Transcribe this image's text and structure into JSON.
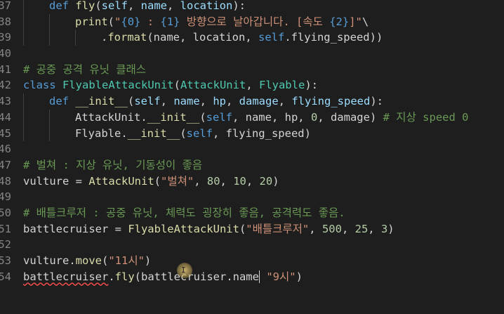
{
  "editor": {
    "lines": [
      {
        "n": "37",
        "tokens": [
          [
            "kw",
            "def "
          ],
          [
            "fn",
            "fly"
          ],
          [
            "plain",
            "("
          ],
          [
            "var",
            "self"
          ],
          [
            "plain",
            ", "
          ],
          [
            "var",
            "name"
          ],
          [
            "plain",
            ", "
          ],
          [
            "var",
            "location"
          ],
          [
            "plain",
            "):"
          ]
        ],
        "indent": 1
      },
      {
        "n": "38",
        "tokens": [
          [
            "fn",
            "print"
          ],
          [
            "plain",
            "("
          ],
          [
            "str",
            "\""
          ],
          [
            "fmt",
            "{0}"
          ],
          [
            "str",
            " : "
          ],
          [
            "fmt",
            "{1}"
          ],
          [
            "str",
            " 방향으로 날아갑니다. [속도 "
          ],
          [
            "fmt",
            "{2}"
          ],
          [
            "str",
            "]\""
          ],
          [
            "plain",
            "\\"
          ]
        ],
        "indent": 2
      },
      {
        "n": "39",
        "tokens": [
          [
            "plain",
            "."
          ],
          [
            "fn",
            "format"
          ],
          [
            "plain",
            "(name, location, "
          ],
          [
            "self",
            "self"
          ],
          [
            "plain",
            ".flying_speed))"
          ]
        ],
        "indent": 3
      },
      {
        "n": "40",
        "tokens": [],
        "indent": 0
      },
      {
        "n": "41",
        "tokens": [
          [
            "cmt",
            "# 공중 공격 유닛 클래스"
          ]
        ],
        "indent": 0
      },
      {
        "n": "42",
        "tokens": [
          [
            "kw",
            "class "
          ],
          [
            "cls",
            "FlyableAttackUnit"
          ],
          [
            "plain",
            "("
          ],
          [
            "cls",
            "AttackUnit"
          ],
          [
            "plain",
            ", "
          ],
          [
            "cls",
            "Flyable"
          ],
          [
            "plain",
            "):"
          ]
        ],
        "indent": 0
      },
      {
        "n": "43",
        "tokens": [
          [
            "kw",
            "def "
          ],
          [
            "fn",
            "__init__"
          ],
          [
            "plain",
            "("
          ],
          [
            "var",
            "self"
          ],
          [
            "plain",
            ", "
          ],
          [
            "var",
            "name"
          ],
          [
            "plain",
            ", "
          ],
          [
            "var",
            "hp"
          ],
          [
            "plain",
            ", "
          ],
          [
            "var",
            "damage"
          ],
          [
            "plain",
            ", "
          ],
          [
            "var",
            "flying_speed"
          ],
          [
            "plain",
            "):"
          ]
        ],
        "indent": 1
      },
      {
        "n": "44",
        "tokens": [
          [
            "plain",
            "AttackUnit."
          ],
          [
            "fn",
            "__init__"
          ],
          [
            "plain",
            "("
          ],
          [
            "self",
            "self"
          ],
          [
            "plain",
            ", name, hp, "
          ],
          [
            "num",
            "0"
          ],
          [
            "plain",
            ", damage) "
          ],
          [
            "cmt",
            "# 지상 speed 0"
          ]
        ],
        "indent": 2
      },
      {
        "n": "45",
        "tokens": [
          [
            "plain",
            "Flyable."
          ],
          [
            "fn",
            "__init__"
          ],
          [
            "plain",
            "("
          ],
          [
            "self",
            "self"
          ],
          [
            "plain",
            ", flying_speed)"
          ]
        ],
        "indent": 2
      },
      {
        "n": "46",
        "tokens": [],
        "indent": 0
      },
      {
        "n": "47",
        "tokens": [
          [
            "cmt",
            "# 벌쳐 : 지상 유닛, 기동성이 좋음"
          ]
        ],
        "indent": 0
      },
      {
        "n": "48",
        "tokens": [
          [
            "plain",
            "vulture = "
          ],
          [
            "fn",
            "AttackUnit"
          ],
          [
            "plain",
            "("
          ],
          [
            "str",
            "\"벌쳐\""
          ],
          [
            "plain",
            ", "
          ],
          [
            "num",
            "80"
          ],
          [
            "plain",
            ", "
          ],
          [
            "num",
            "10"
          ],
          [
            "plain",
            ", "
          ],
          [
            "num",
            "20"
          ],
          [
            "plain",
            ")"
          ]
        ],
        "indent": 0
      },
      {
        "n": "49",
        "tokens": [],
        "indent": 0
      },
      {
        "n": "50",
        "tokens": [
          [
            "cmt",
            "# 배틀크루저 : 공중 유닛, 체력도 굉장히 좋음, 공격력도 좋음."
          ]
        ],
        "indent": 0
      },
      {
        "n": "51",
        "tokens": [
          [
            "plain",
            "battlecruiser = "
          ],
          [
            "fn",
            "FlyableAttackUnit"
          ],
          [
            "plain",
            "("
          ],
          [
            "str",
            "\"배틀크루저\""
          ],
          [
            "plain",
            ", "
          ],
          [
            "num",
            "500"
          ],
          [
            "plain",
            ", "
          ],
          [
            "num",
            "25"
          ],
          [
            "plain",
            ", "
          ],
          [
            "num",
            "3"
          ],
          [
            "plain",
            ")"
          ]
        ],
        "indent": 0
      },
      {
        "n": "52",
        "tokens": [],
        "indent": 0
      },
      {
        "n": "53",
        "tokens": [
          [
            "plain",
            "vulture."
          ],
          [
            "fn",
            "move"
          ],
          [
            "plain",
            "("
          ],
          [
            "str",
            "\"11시\""
          ],
          [
            "plain",
            ")"
          ]
        ],
        "indent": 0
      },
      {
        "n": "54",
        "tokens": [
          [
            "squig",
            "battlecruiser"
          ],
          [
            "plain",
            "."
          ],
          [
            "fn",
            "fly"
          ],
          [
            "plain",
            "(battlecruiser.name"
          ],
          [
            "cursor",
            ""
          ],
          [
            "plain",
            " "
          ],
          [
            "str",
            "\"9시\""
          ],
          [
            "plain",
            ")"
          ]
        ],
        "indent": 0
      }
    ]
  },
  "mouse_cursor_glyph": "I"
}
